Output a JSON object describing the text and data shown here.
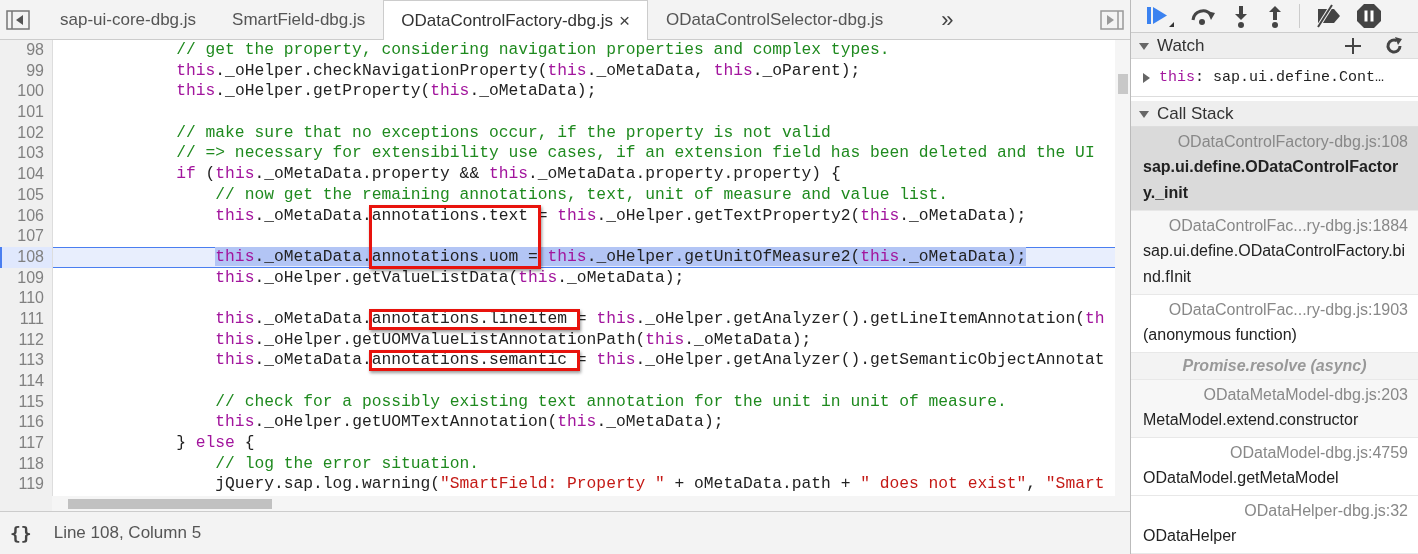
{
  "tabs": [
    {
      "label": "sap-ui-core-dbg.js",
      "selected": false,
      "closable": false
    },
    {
      "label": "SmartField-dbg.js",
      "selected": false,
      "closable": false
    },
    {
      "label": "ODataControlFactory-dbg.js",
      "selected": true,
      "closable": true,
      "close_glyph": "×"
    },
    {
      "label": "ODataControlSelector-dbg.js",
      "selected": false,
      "closable": false
    }
  ],
  "more_tabs_glyph": "»",
  "code_lines": [
    {
      "number": "98",
      "current": false,
      "selected": false,
      "tokens": [
        {
          "kind": "comment",
          "text": "            // get the property, considering navigation properties and complex types."
        }
      ]
    },
    {
      "number": "99",
      "current": false,
      "selected": false,
      "tokens": [
        {
          "kind": "keyword",
          "text": "            this"
        },
        {
          "kind": "plain",
          "text": "._oHelper.checkNavigationProperty("
        },
        {
          "kind": "keyword",
          "text": "this"
        },
        {
          "kind": "plain",
          "text": "._oMetaData, "
        },
        {
          "kind": "keyword",
          "text": "this"
        },
        {
          "kind": "plain",
          "text": "._oParent);"
        }
      ]
    },
    {
      "number": "100",
      "current": false,
      "selected": false,
      "tokens": [
        {
          "kind": "keyword",
          "text": "            this"
        },
        {
          "kind": "plain",
          "text": "._oHelper.getProperty("
        },
        {
          "kind": "keyword",
          "text": "this"
        },
        {
          "kind": "plain",
          "text": "._oMetaData);"
        }
      ]
    },
    {
      "number": "101",
      "current": false,
      "selected": false
    },
    {
      "number": "102",
      "current": false,
      "selected": false,
      "tokens": [
        {
          "kind": "comment",
          "text": "            // make sure that no exceptions occur, if the property is not valid"
        }
      ]
    },
    {
      "number": "103",
      "current": false,
      "selected": false,
      "tokens": [
        {
          "kind": "comment",
          "text": "            // => necessary for extensibility use cases, if an extension field has been deleted and the UI"
        }
      ]
    },
    {
      "number": "104",
      "current": false,
      "selected": false,
      "tokens": [
        {
          "kind": "keyword",
          "text": "            if"
        },
        {
          "kind": "plain",
          "text": " ("
        },
        {
          "kind": "keyword",
          "text": "this"
        },
        {
          "kind": "plain",
          "text": "._oMetaData.property && "
        },
        {
          "kind": "keyword",
          "text": "this"
        },
        {
          "kind": "plain",
          "text": "._oMetaData.property.property) {"
        }
      ]
    },
    {
      "number": "105",
      "current": false,
      "selected": false,
      "tokens": [
        {
          "kind": "comment",
          "text": "                // now get the remaining annotations, text, unit of measure and value list."
        }
      ]
    },
    {
      "number": "106",
      "current": false,
      "selected": false,
      "tokens": [
        {
          "kind": "keyword",
          "text": "                this"
        },
        {
          "kind": "plain",
          "text": "._oMetaData."
        },
        {
          "kind": "plain",
          "text": "annotations.text ",
          "boxed": true,
          "box_tall": true
        },
        {
          "kind": "plain",
          "text": "= "
        },
        {
          "kind": "keyword",
          "text": "this"
        },
        {
          "kind": "plain",
          "text": "._oHelper.getTextProperty2("
        },
        {
          "kind": "keyword",
          "text": "this"
        },
        {
          "kind": "plain",
          "text": "._oMetaData);"
        }
      ]
    },
    {
      "number": "107",
      "current": false,
      "selected": false
    },
    {
      "number": "108",
      "current": true,
      "selected": true,
      "tokens": [
        {
          "kind": "keyword",
          "text": "                this"
        },
        {
          "kind": "plain",
          "text": "._oMetaData.annotations.uom = "
        },
        {
          "kind": "keyword",
          "text": "this"
        },
        {
          "kind": "plain",
          "text": "._oHelper.getUnitOfMeasure2("
        },
        {
          "kind": "keyword",
          "text": "this"
        },
        {
          "kind": "plain",
          "text": "._oMetaData);"
        }
      ]
    },
    {
      "number": "109",
      "current": false,
      "selected": false,
      "tokens": [
        {
          "kind": "keyword",
          "text": "                this"
        },
        {
          "kind": "plain",
          "text": "._oHelper.getValueListData("
        },
        {
          "kind": "keyword",
          "text": "this"
        },
        {
          "kind": "plain",
          "text": "._oMetaData);"
        }
      ]
    },
    {
      "number": "110",
      "current": false,
      "selected": false
    },
    {
      "number": "111",
      "current": false,
      "selected": false,
      "tokens": [
        {
          "kind": "keyword",
          "text": "                this"
        },
        {
          "kind": "plain",
          "text": "._oMetaData."
        },
        {
          "kind": "plain",
          "text": "annotations.lineitem ",
          "boxed": true,
          "box_tall": false
        },
        {
          "kind": "plain",
          "text": "= "
        },
        {
          "kind": "keyword",
          "text": "this"
        },
        {
          "kind": "plain",
          "text": "._oHelper.getAnalyzer().getLineItemAnnotation("
        },
        {
          "kind": "keyword",
          "text": "th"
        }
      ]
    },
    {
      "number": "112",
      "current": false,
      "selected": false,
      "tokens": [
        {
          "kind": "keyword",
          "text": "                this"
        },
        {
          "kind": "plain",
          "text": "._oHelper.getUOMValueListAnnotationPath("
        },
        {
          "kind": "keyword",
          "text": "this"
        },
        {
          "kind": "plain",
          "text": "._oMetaData);"
        }
      ]
    },
    {
      "number": "113",
      "current": false,
      "selected": false,
      "tokens": [
        {
          "kind": "keyword",
          "text": "                this"
        },
        {
          "kind": "plain",
          "text": "._oMetaData."
        },
        {
          "kind": "plain",
          "text": "annotations.semantic ",
          "boxed": true,
          "box_tall": false
        },
        {
          "kind": "plain",
          "text": "= "
        },
        {
          "kind": "keyword",
          "text": "this"
        },
        {
          "kind": "plain",
          "text": "._oHelper.getAnalyzer().getSemanticObjectAnnotat"
        }
      ]
    },
    {
      "number": "114",
      "current": false,
      "selected": false
    },
    {
      "number": "115",
      "current": false,
      "selected": false,
      "tokens": [
        {
          "kind": "comment",
          "text": "                // check for a possibly existing text annotation for the unit in unit of measure."
        }
      ]
    },
    {
      "number": "116",
      "current": false,
      "selected": false,
      "tokens": [
        {
          "kind": "keyword",
          "text": "                this"
        },
        {
          "kind": "plain",
          "text": "._oHelper.getUOMTextAnnotation("
        },
        {
          "kind": "keyword",
          "text": "this"
        },
        {
          "kind": "plain",
          "text": "._oMetaData);"
        }
      ]
    },
    {
      "number": "117",
      "current": false,
      "selected": false,
      "tokens": [
        {
          "kind": "plain",
          "text": "            } "
        },
        {
          "kind": "keyword",
          "text": "else"
        },
        {
          "kind": "plain",
          "text": " {"
        }
      ]
    },
    {
      "number": "118",
      "current": false,
      "selected": false,
      "tokens": [
        {
          "kind": "comment",
          "text": "                // log the error situation."
        }
      ]
    },
    {
      "number": "119",
      "current": false,
      "selected": false,
      "tokens": [
        {
          "kind": "plain",
          "text": "                jQuery.sap.log.warning("
        },
        {
          "kind": "string",
          "text": "\"SmartField: Property \""
        },
        {
          "kind": "plain",
          "text": " + oMetaData.path + "
        },
        {
          "kind": "string",
          "text": "\" does not exist\""
        },
        {
          "kind": "plain",
          "text": ", "
        },
        {
          "kind": "string",
          "text": "\"Smart"
        }
      ]
    }
  ],
  "status_bar": {
    "pretty_print_glyph": "{}",
    "position": "Line 108, Column 5"
  },
  "watch": {
    "title": "Watch",
    "expanded": true,
    "expressions": [
      {
        "name": "this",
        "value": ": sap.ui.define.Cont…",
        "expanded": false
      }
    ]
  },
  "call_stack": {
    "title": "Call Stack",
    "expanded": true,
    "frames": [
      {
        "kind": "frame",
        "location": "ODataControlFactory-dbg.js:108",
        "function": "sap.ui.define.ODataControlFactory._init",
        "selected": true
      },
      {
        "kind": "frame",
        "location": "ODataControlFac...ry-dbg.js:1884",
        "function": "sap.ui.define.ODataControlFactory.bind.fInit",
        "selected": false
      },
      {
        "kind": "frame",
        "location": "ODataControlFac...ry-dbg.js:1903",
        "function": "(anonymous function)",
        "selected": false
      },
      {
        "kind": "async",
        "label": "Promise.resolve (async)",
        "selected": false
      },
      {
        "kind": "frame",
        "location": "ODataMetaModel-dbg.js:203",
        "function": "MetaModel.extend.constructor",
        "selected": false
      },
      {
        "kind": "frame",
        "location": "ODataModel-dbg.js:4759",
        "function": "ODataModel.getMetaModel",
        "selected": false
      },
      {
        "kind": "frame",
        "location": "ODataHelper-dbg.js:32",
        "function": "ODataHelper",
        "selected": false
      }
    ]
  }
}
